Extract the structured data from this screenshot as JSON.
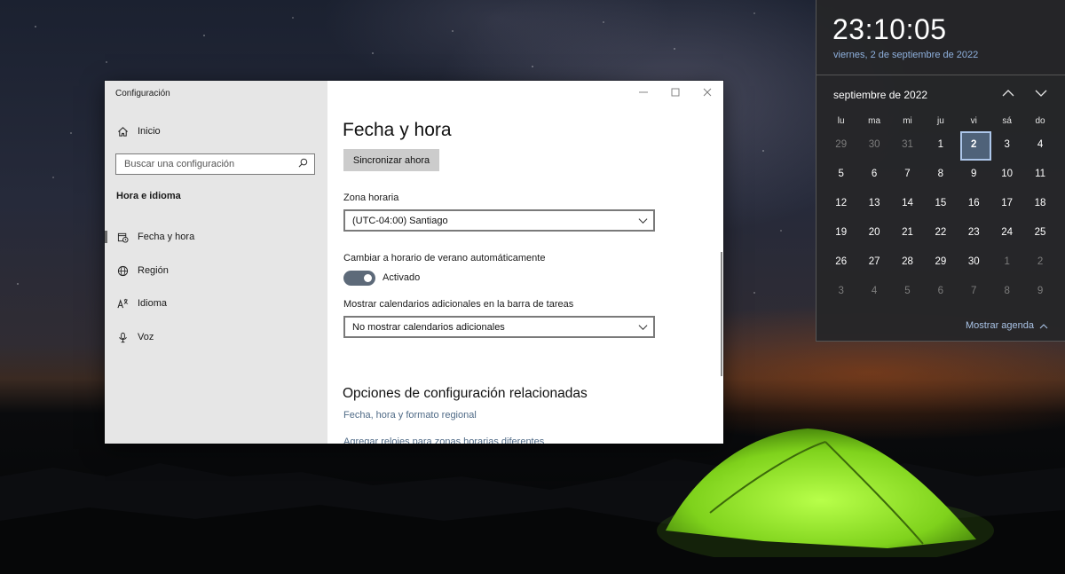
{
  "settings": {
    "app_title": "Configuración",
    "nav": {
      "home": "Inicio",
      "section_header": "Hora e idioma",
      "items": [
        {
          "label": "Fecha y hora",
          "icon": "calendar-clock-icon",
          "active": true
        },
        {
          "label": "Región",
          "icon": "globe-icon",
          "active": false
        },
        {
          "label": "Idioma",
          "icon": "language-icon",
          "active": false
        },
        {
          "label": "Voz",
          "icon": "microphone-icon",
          "active": false
        }
      ]
    },
    "search": {
      "placeholder": "Buscar una configuración"
    },
    "page": {
      "title": "Fecha y hora",
      "sync_button": "Sincronizar ahora",
      "timezone_label": "Zona horaria",
      "timezone_value": "(UTC-04:00) Santiago",
      "dst_label": "Cambiar a horario de verano automáticamente",
      "dst_toggle_label": "Activado",
      "dst_enabled": true,
      "calendars_label": "Mostrar calendarios adicionales en la barra de tareas",
      "calendars_value": "No mostrar calendarios adicionales",
      "related_title": "Opciones de configuración relacionadas",
      "related_links": [
        "Fecha, hora y formato regional",
        "Agregar relojes para zonas horarias diferentes"
      ]
    }
  },
  "flyout": {
    "time": "23:10:05",
    "long_date": "viernes, 2 de septiembre de 2022",
    "month_label": "septiembre de 2022",
    "weekdays": [
      "lu",
      "ma",
      "mi",
      "ju",
      "vi",
      "sá",
      "do"
    ],
    "weeks": [
      [
        "29",
        "30",
        "31",
        "1",
        "2",
        "3",
        "4"
      ],
      [
        "5",
        "6",
        "7",
        "8",
        "9",
        "10",
        "11"
      ],
      [
        "12",
        "13",
        "14",
        "15",
        "16",
        "17",
        "18"
      ],
      [
        "19",
        "20",
        "21",
        "22",
        "23",
        "24",
        "25"
      ],
      [
        "26",
        "27",
        "28",
        "29",
        "30",
        "1",
        "2"
      ],
      [
        "3",
        "4",
        "5",
        "6",
        "7",
        "8",
        "9"
      ]
    ],
    "today_index": 4,
    "agenda_label": "Mostrar agenda"
  },
  "colors": {
    "accent": "#4f6279",
    "link": "#4f6a86",
    "flyout_date": "#8fb1de",
    "toggle_on": "#5d6a79"
  }
}
